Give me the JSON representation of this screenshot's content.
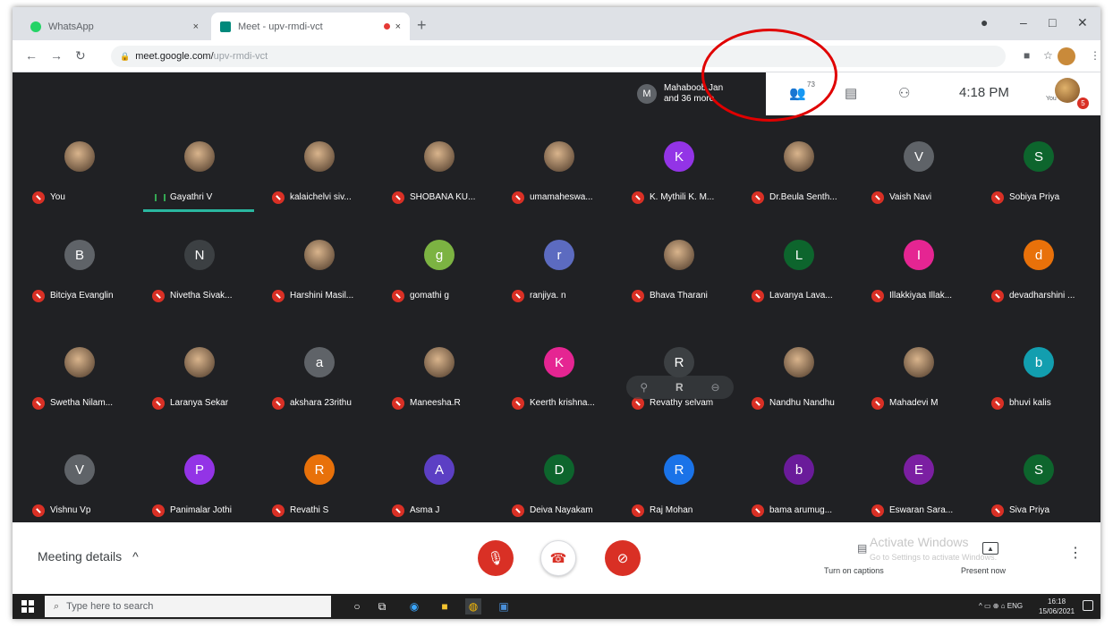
{
  "browser": {
    "tabs": [
      {
        "title": "WhatsApp",
        "close": "×",
        "favicon_color": "#25d366"
      },
      {
        "title": "Meet - upv-rmdi-vct",
        "close": "×",
        "favicon_color": "#00897b"
      }
    ],
    "new_tab": "+",
    "url_main": "meet.google.com/",
    "url_dim": "upv-rmdi-vct",
    "window_min": "–",
    "window_max": "□",
    "window_close": "✕"
  },
  "meet": {
    "presenter_initial": "M",
    "presenter_line1": "Mahaboob Jan",
    "presenter_line2": "and 36 more",
    "people_count": "73",
    "time": "4:18 PM",
    "you_label": "You",
    "badge": "5"
  },
  "participants": [
    {
      "name": "You",
      "initial": "",
      "color": "photo"
    },
    {
      "name": "Gayathri V",
      "initial": "",
      "color": "photo",
      "speaking": true
    },
    {
      "name": "kalaichelvi siv...",
      "initial": "",
      "color": "photo"
    },
    {
      "name": "SHOBANA KU...",
      "initial": "",
      "color": "photo"
    },
    {
      "name": "umamaheswa...",
      "initial": "",
      "color": "photo"
    },
    {
      "name": "K. Mythili K. M...",
      "initial": "K",
      "color": "#9334e6"
    },
    {
      "name": "Dr.Beula Senth...",
      "initial": "",
      "color": "photo"
    },
    {
      "name": "Vaish Navi",
      "initial": "V",
      "color": "#5f6368"
    },
    {
      "name": "Sobiya Priya",
      "initial": "S",
      "color": "#0d652d"
    },
    {
      "name": "Bitciya Evanglin",
      "initial": "B",
      "color": "#5f6368"
    },
    {
      "name": "Nivetha Sivak...",
      "initial": "N",
      "color": "#3c4043"
    },
    {
      "name": "Harshini Masil...",
      "initial": "",
      "color": "photo"
    },
    {
      "name": "gomathi g",
      "initial": "g",
      "color": "#7cb342"
    },
    {
      "name": "ranjiya. n",
      "initial": "r",
      "color": "#5c6bc0"
    },
    {
      "name": "Bhava Tharani",
      "initial": "",
      "color": "photo"
    },
    {
      "name": "Lavanya Lava...",
      "initial": "L",
      "color": "#0d652d"
    },
    {
      "name": "Illakkiyaa Illak...",
      "initial": "I",
      "color": "#e52592"
    },
    {
      "name": "devadharshini ...",
      "initial": "d",
      "color": "#e8710a"
    },
    {
      "name": "Swetha Nilam...",
      "initial": "",
      "color": "photo"
    },
    {
      "name": "Laranya Sekar",
      "initial": "",
      "color": "photo"
    },
    {
      "name": "akshara 23rithu",
      "initial": "a",
      "color": "#5f6368"
    },
    {
      "name": "Maneesha.R",
      "initial": "",
      "color": "photo"
    },
    {
      "name": "Keerth krishna...",
      "initial": "K",
      "color": "#e52592"
    },
    {
      "name": "Revathy selvam",
      "initial": "R",
      "color": "#3c4043"
    },
    {
      "name": "Nandhu Nandhu",
      "initial": "",
      "color": "photo"
    },
    {
      "name": "Mahadevi M",
      "initial": "",
      "color": "photo"
    },
    {
      "name": "bhuvi kalis",
      "initial": "b",
      "color": "#129eaf"
    },
    {
      "name": "Vishnu Vp",
      "initial": "V",
      "color": "#5f6368"
    },
    {
      "name": "Panimalar Jothi",
      "initial": "P",
      "color": "#9334e6"
    },
    {
      "name": "Revathi S",
      "initial": "R",
      "color": "#e8710a"
    },
    {
      "name": "Asma J",
      "initial": "A",
      "color": "#5c3fc4"
    },
    {
      "name": "Deiva Nayakam",
      "initial": "D",
      "color": "#0d652d"
    },
    {
      "name": "Raj Mohan",
      "initial": "R",
      "color": "#1a73e8"
    },
    {
      "name": "bama arumug...",
      "initial": "b",
      "color": "#6a1b9a"
    },
    {
      "name": "Eswaran Sara...",
      "initial": "E",
      "color": "#7b1fa2"
    },
    {
      "name": "Siva Priya",
      "initial": "S",
      "color": "#0d652d"
    }
  ],
  "hover_controls": {
    "pin": "⚲",
    "initial": "R",
    "remove": "⊖"
  },
  "bottom": {
    "meeting_details": "Meeting details",
    "chevron": "^",
    "captions": "Turn on captions",
    "present": "Present now",
    "activate_title": "Activate Windows",
    "activate_sub": "Go to Settings to activate Windows.",
    "more": "⋮"
  },
  "taskbar": {
    "search_placeholder": "Type here to search",
    "tray": "^  ▭  ⊕  ⌂  ENG",
    "time": "16:18",
    "date": "15/06/2021"
  }
}
